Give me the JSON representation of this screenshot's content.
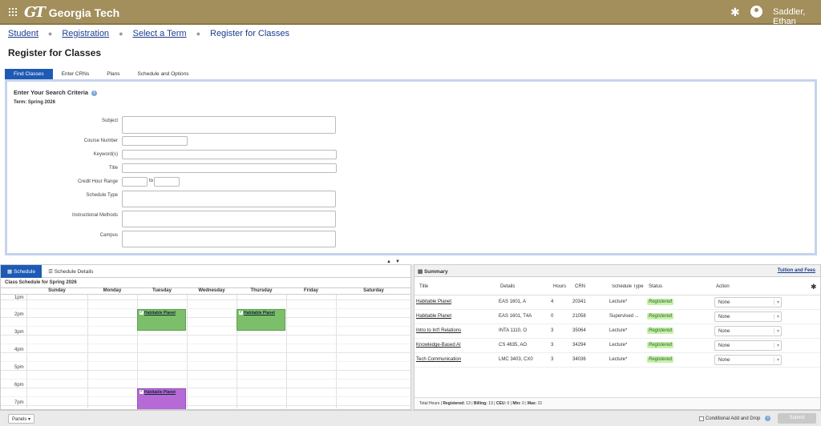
{
  "header": {
    "logo_mark": "GT",
    "logo_text": "Georgia Tech",
    "user_name": "Saddler, Ethan"
  },
  "breadcrumb": {
    "items": [
      "Student",
      "Registration",
      "Select a Term"
    ],
    "current": "Register for Classes"
  },
  "page_title": "Register for Classes",
  "tabs": [
    "Find Classes",
    "Enter CRNs",
    "Plans",
    "Schedule and Options"
  ],
  "search": {
    "title": "Enter Your Search Criteria",
    "term": "Term: Spring 2026",
    "labels": {
      "subject": "Subject",
      "course_number": "Course Number",
      "keywords": "Keyword(s)",
      "title": "Title",
      "credit_hours": "Credit Hour Range",
      "to": "to",
      "schedule_type": "Schedule Type",
      "instructional_methods": "Instructional Methods",
      "campus": "Campus"
    }
  },
  "schedule": {
    "tabs": [
      "Schedule",
      "Schedule Details"
    ],
    "title": "Class Schedule for Spring 2026",
    "days": [
      "Sunday",
      "Monday",
      "Tuesday",
      "Wednesday",
      "Thursday",
      "Friday",
      "Saturday"
    ],
    "times": [
      "1pm",
      "2pm",
      "3pm",
      "4pm",
      "5pm",
      "6pm",
      "7pm"
    ],
    "events": [
      {
        "label": "Habitable Planet",
        "day": "Tuesday",
        "color": "#7bbf6a"
      },
      {
        "label": "Habitable Planet",
        "day": "Thursday",
        "color": "#7bbf6a"
      },
      {
        "label": "Habitable Planet",
        "day": "Tuesday",
        "color": "#b56ad6"
      }
    ]
  },
  "summary": {
    "title": "Summary",
    "tuition_link": "Tuition and Fees",
    "columns": [
      "Title",
      "Details",
      "Hours",
      "CRN",
      "Schedule Type",
      "Status",
      "Action"
    ],
    "rows": [
      {
        "title": "Habitable Planet",
        "details": "EAS 1601, A",
        "hours": "4",
        "crn": "20341",
        "type": "Lecture*",
        "status": "Registered",
        "action": "None"
      },
      {
        "title": "Habitable Planet",
        "details": "EAS 1601, T4A",
        "hours": "0",
        "crn": "21058",
        "type": "Supervised ...",
        "status": "Registered",
        "action": "None"
      },
      {
        "title": "Intro to Int'l Relations",
        "details": "INTA 1110, O",
        "hours": "3",
        "crn": "35064",
        "type": "Lecture*",
        "status": "Registered",
        "action": "None"
      },
      {
        "title": "Knowledge-Based AI",
        "details": "CS 4635, AO",
        "hours": "3",
        "crn": "34294",
        "type": "Lecture*",
        "status": "Registered",
        "action": "None"
      },
      {
        "title": "Tech Communication",
        "details": "LMC 3403, CX0",
        "hours": "3",
        "crn": "34036",
        "type": "Lecture*",
        "status": "Registered",
        "action": "None"
      }
    ],
    "totals": {
      "prefix": "Total Hours |",
      "registered_label": "Registered:",
      "registered": "13",
      "billing_label": "Billing:",
      "billing": "13",
      "ceu_label": "CEU:",
      "ceu": "0",
      "min_label": "Min:",
      "min": "0",
      "max_label": "Max:",
      "max": "21"
    }
  },
  "footer": {
    "panels": "Panels",
    "conditional": "Conditional Add and Drop",
    "submit": "Submit"
  },
  "colors": {
    "header": "#a38f5c",
    "accent": "#1e5ab5",
    "registered": "#c7f0a9"
  }
}
